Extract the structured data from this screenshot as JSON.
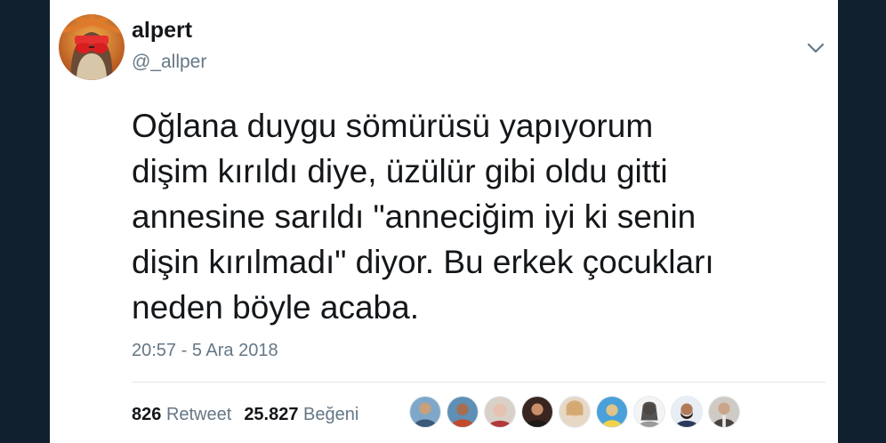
{
  "tweet": {
    "display_name": "alpert",
    "handle": "@_allper",
    "text": "Oğlana duygu sömürüsü yapıyorum\ndişim kırıldı diye, üzülür gibi oldu gitti\nannesine sarıldı \"anneciğim iyi ki senin\ndişin kırılmadı\" diyor. Bu erkek çocukları\nneden böyle acaba.",
    "timestamp": "20:57 - 5 Ara 2018",
    "retweet_count": "826",
    "retweet_label": "Retweet",
    "like_count": "25.827",
    "like_label": "Beğeni"
  },
  "icons": {
    "more_menu": "chevron-down-icon"
  },
  "colors": {
    "page_background": "#10202f",
    "card_background": "#ffffff",
    "primary_text": "#14171a",
    "secondary_text": "#657786",
    "divider": "#e1e8ed"
  }
}
